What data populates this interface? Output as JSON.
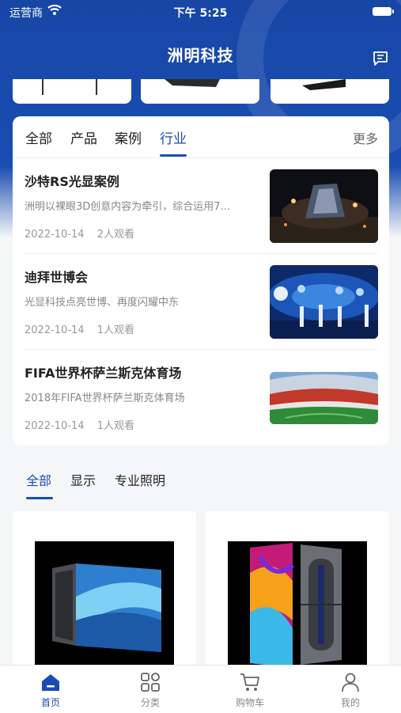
{
  "status": {
    "carrier": "运营商",
    "time": "下午 5:25"
  },
  "header": {
    "title": "洲明科技"
  },
  "news": {
    "tabs": [
      {
        "label": "全部"
      },
      {
        "label": "产品"
      },
      {
        "label": "案例"
      },
      {
        "label": "行业",
        "active": true
      }
    ],
    "more_label": "更多",
    "items": [
      {
        "title": "沙特RS光显案例",
        "desc": "洲明以裸眼3D创意内容为牵引，综合运用7...",
        "date": "2022-10-14",
        "views": "2人观看"
      },
      {
        "title": "迪拜世博会",
        "desc": "光显科技点亮世博、再度闪耀中东",
        "date": "2022-10-14",
        "views": "1人观看"
      },
      {
        "title": "FIFA世界杯萨兰斯克体育场",
        "desc": "2018年FIFA世界杯萨兰斯克体育场",
        "date": "2022-10-14",
        "views": "1人观看"
      }
    ]
  },
  "categories": [
    {
      "label": "全部",
      "active": true
    },
    {
      "label": "显示"
    },
    {
      "label": "专业照明"
    }
  ],
  "tabbar": [
    {
      "label": "首页",
      "icon": "home-icon",
      "active": true
    },
    {
      "label": "分类",
      "icon": "grid-icon"
    },
    {
      "label": "购物车",
      "icon": "cart-icon"
    },
    {
      "label": "我的",
      "icon": "user-icon"
    }
  ],
  "colors": {
    "brand": "#1a4db2",
    "header_bg": "#1746a6",
    "page_bg": "#f5f6f8"
  }
}
